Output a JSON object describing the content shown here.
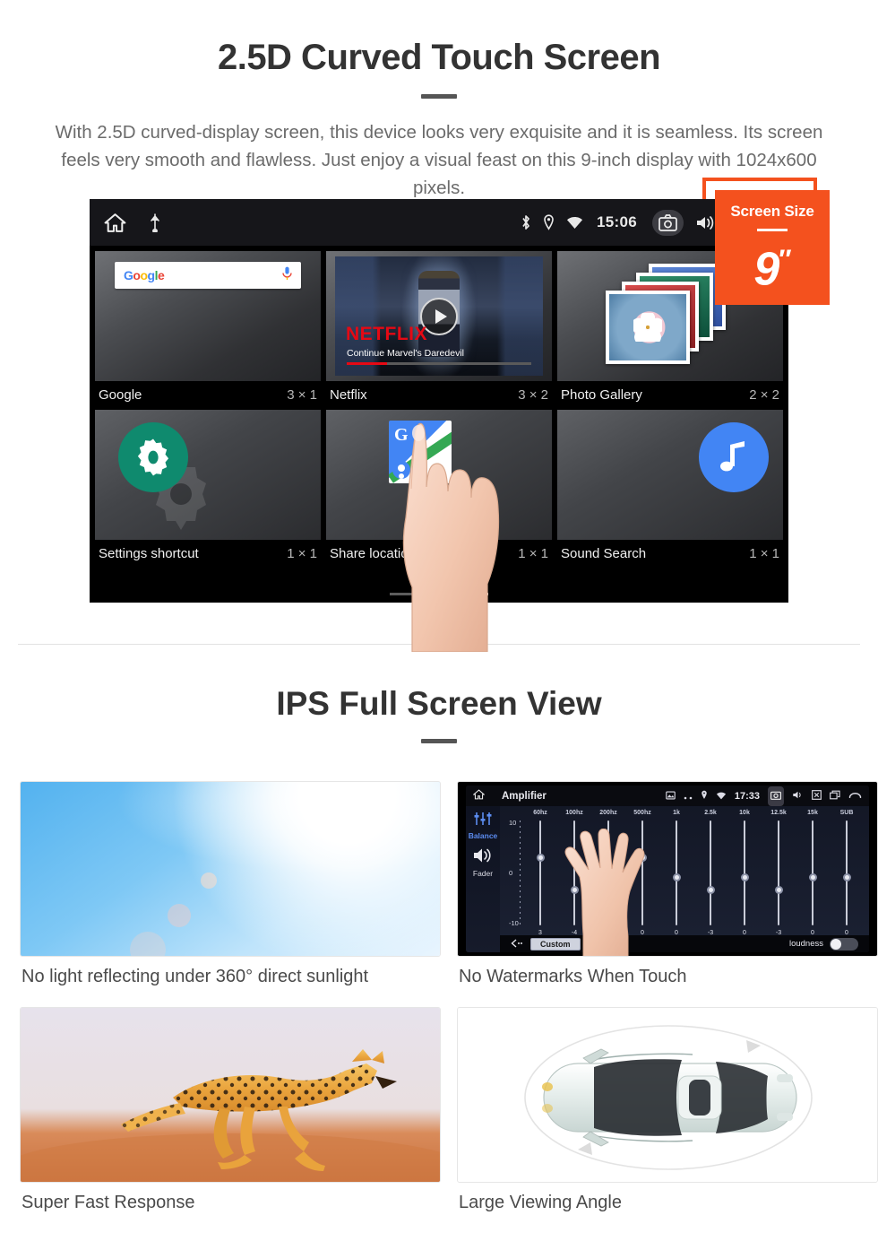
{
  "section1": {
    "title": "2.5D Curved Touch Screen",
    "description": "With 2.5D curved-display screen, this device looks very exquisite and it is seamless. Its screen feels very smooth and flawless. Just enjoy a visual feast on this 9-inch display with 1024x600 pixels.",
    "badge": {
      "label": "Screen Size",
      "value": "9",
      "unit": "″",
      "color": "#f4511e"
    },
    "statusbar": {
      "time": "15:06",
      "icons_left": [
        "home-icon",
        "usb-icon"
      ],
      "icons_right": [
        "bluetooth-icon",
        "location-icon",
        "wifi-icon",
        "camera-icon",
        "volume-icon",
        "close-icon",
        "recents-icon"
      ]
    },
    "widgets": [
      {
        "name": "Google",
        "size": "3 × 1",
        "icon": "google-search-widget",
        "search_placeholder": "Google"
      },
      {
        "name": "Netflix",
        "size": "3 × 2",
        "icon": "netflix-widget",
        "brand": "NETFLIX",
        "subtitle": "Continue Marvel's Daredevil"
      },
      {
        "name": "Photo Gallery",
        "size": "2 × 2",
        "icon": "photo-gallery-widget"
      },
      {
        "name": "Settings shortcut",
        "size": "1 × 1",
        "icon": "gear-icon"
      },
      {
        "name": "Share location",
        "size": "1 × 1",
        "icon": "google-maps-icon"
      },
      {
        "name": "Sound Search",
        "size": "1 × 1",
        "icon": "music-note-icon"
      }
    ],
    "page_indicator": {
      "count": 3,
      "active": 3
    }
  },
  "section2": {
    "title": "IPS Full Screen View",
    "cards": [
      {
        "caption": "No light reflecting under 360° direct sunlight",
        "image": "blue-sky-with-sun-flare"
      },
      {
        "caption": "No Watermarks When Touch",
        "image": "amplifier-equalizer-screen"
      },
      {
        "caption": "Super Fast Response",
        "image": "running-cheetah"
      },
      {
        "caption": "Large Viewing Angle",
        "image": "car-top-view-rotation"
      }
    ]
  },
  "amplifier": {
    "title": "Amplifier",
    "time": "17:33",
    "side_items": [
      {
        "label": "Balance",
        "icon": "sliders-icon",
        "active": true
      },
      {
        "label": "Fader",
        "icon": "speaker-icon",
        "active": false
      }
    ],
    "axis_top": "10",
    "axis_mid": "0",
    "axis_bottom": "-10",
    "preset": "Custom",
    "loudness_label": "loudness",
    "loudness_on": false,
    "bands": [
      "60hz",
      "100hz",
      "200hz",
      "500hz",
      "1k",
      "2.5k",
      "10k",
      "12.5k",
      "15k",
      "SUB"
    ],
    "values": [
      "3",
      "-4",
      "0",
      "0",
      "0",
      "-3",
      "0",
      "-3",
      "0",
      "0"
    ],
    "knob_pct": [
      32,
      62,
      50,
      32,
      50,
      62,
      50,
      62,
      50,
      50
    ]
  }
}
